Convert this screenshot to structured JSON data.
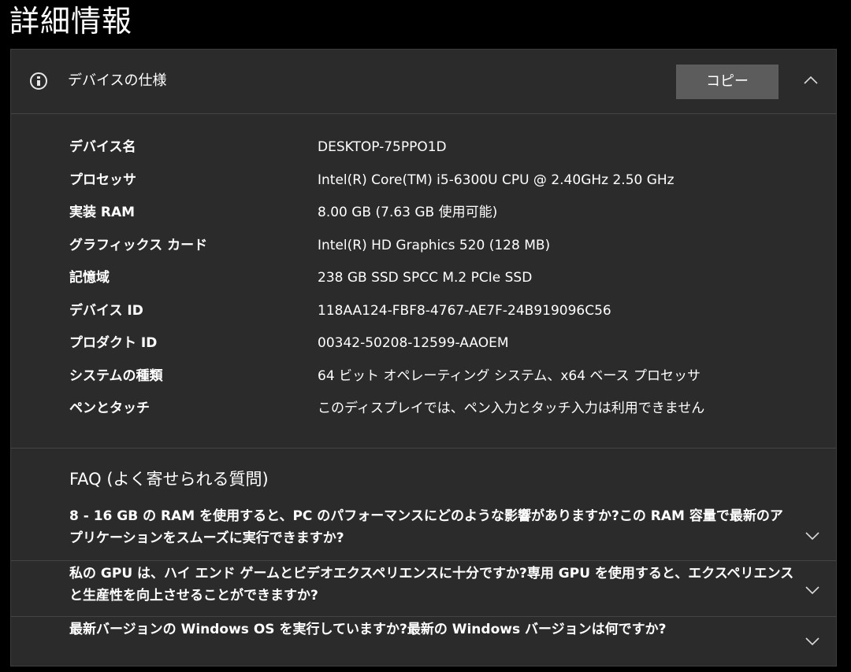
{
  "page": {
    "title": "詳細情報"
  },
  "device_specs": {
    "title": "デバイスの仕様",
    "copy_label": "コピー",
    "items": [
      {
        "key": "デバイス名",
        "value": "DESKTOP-75PPO1D"
      },
      {
        "key": "プロセッサ",
        "value": "Intel(R) Core(TM) i5-6300U CPU @ 2.40GHz   2.50 GHz"
      },
      {
        "key": "実装 RAM",
        "value": "8.00 GB (7.63 GB 使用可能)"
      },
      {
        "key": "グラフィックス カード",
        "value": "Intel(R) HD Graphics 520 (128 MB)"
      },
      {
        "key": "記憶域",
        "value": "238 GB SSD SPCC M.2 PCIe SSD"
      },
      {
        "key": "デバイス ID",
        "value": "118AA124-FBF8-4767-AE7F-24B919096C56"
      },
      {
        "key": "プロダクト ID",
        "value": "00342-50208-12599-AAOEM"
      },
      {
        "key": "システムの種類",
        "value": "64 ビット オペレーティング システム、x64 ベース プロセッサ"
      },
      {
        "key": "ペンとタッチ",
        "value": "このディスプレイでは、ペン入力とタッチ入力は利用できません"
      }
    ]
  },
  "faq": {
    "title": "FAQ (よく寄せられる質問)",
    "items": [
      {
        "question": "8 - 16 GB の RAM を使用すると、PC のパフォーマンスにどのような影響がありますか?この RAM 容量で最新のアプリケーションをスムーズに実行できますか?"
      },
      {
        "question": "私の GPU は、ハイ エンド ゲームとビデオエクスペリエンスに十分ですか?専用 GPU を使用すると、エクスペリエンスと生産性を向上させることができますか?"
      },
      {
        "question": "最新バージョンの Windows OS を実行していますか?最新の Windows バージョンは何ですか?"
      }
    ]
  },
  "colors": {
    "page_background": "#000000",
    "panel_background": "#2b2b2b",
    "button_background": "#5c5c5c",
    "divider": "#444444",
    "text": "#ffffff"
  },
  "icons": {
    "info": "info-icon",
    "collapse": "chevron-up-icon",
    "expand": "chevron-down-icon"
  }
}
